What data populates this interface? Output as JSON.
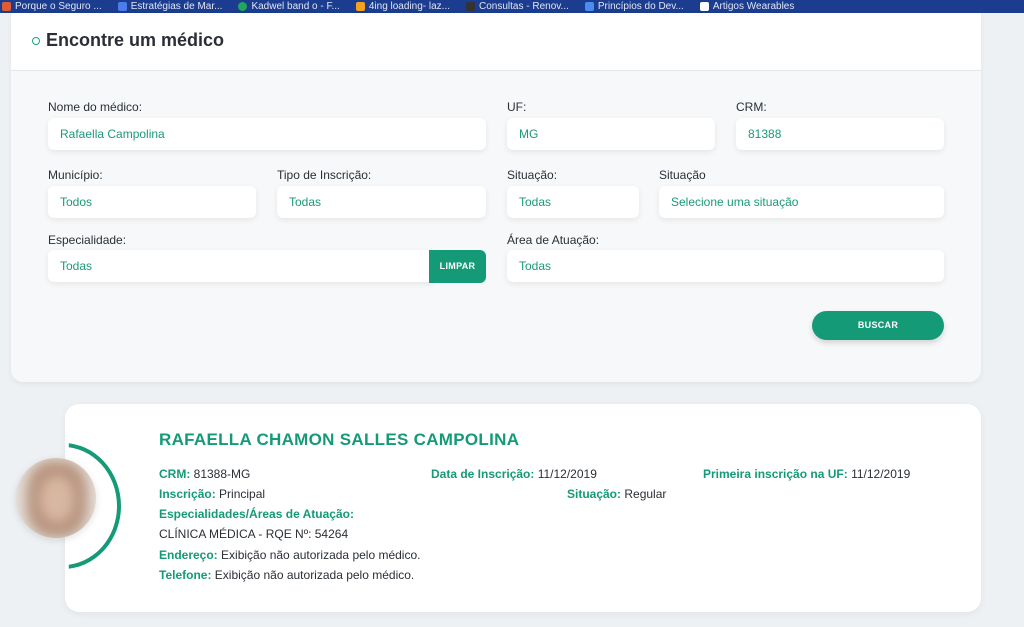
{
  "bookmarks": [
    {
      "label": "Porque o Seguro ...",
      "color": "#e35b2c"
    },
    {
      "label": "Estratégias de Mar...",
      "color": "#4b7bec"
    },
    {
      "label": "Kadwel band o - F...",
      "color": "#1fa85a"
    },
    {
      "label": "4ing loading- laz...",
      "color": "#f3a21c"
    },
    {
      "label": "Consultas - Renov...",
      "color": "#333333"
    },
    {
      "label": "Princípios do Dev...",
      "color": "#4a8cf0"
    },
    {
      "label": "Artigos Wearables",
      "color": "#ffffff"
    }
  ],
  "search": {
    "title": "Encontre um médico",
    "fields": {
      "nome": {
        "label": "Nome do médico:",
        "value": "Rafaella Campolina"
      },
      "uf": {
        "label": "UF:",
        "value": "MG"
      },
      "crm": {
        "label": "CRM:",
        "value": "81388"
      },
      "municipio": {
        "label": "Município:",
        "value": "Todos"
      },
      "tipo": {
        "label": "Tipo de Inscrição:",
        "value": "Todas"
      },
      "situacao1": {
        "label": "Situação:",
        "value": "Todas"
      },
      "situacao2": {
        "label": "Situação",
        "value": "Selecione uma situação"
      },
      "especialidade": {
        "label": "Especialidade:",
        "value": "Todas"
      },
      "area": {
        "label": "Área de Atuação:",
        "value": "Todas"
      }
    },
    "limpar_label": "LIMPAR",
    "buscar_label": "BUSCAR"
  },
  "result": {
    "name": "RAFAELLA CHAMON SALLES CAMPOLINA",
    "crm_key": "CRM:",
    "crm_value": " 81388-MG",
    "data_key": "Data de Inscrição:",
    "data_value": " 11/12/2019",
    "primeira_key": "Primeira inscrição na UF:",
    "primeira_value": " 11/12/2019",
    "inscricao_key": "Inscrição:",
    "inscricao_value": " Principal",
    "situacao_key": "Situação:",
    "situacao_value": " Regular",
    "especialidades_key": "Especialidades/Áreas de Atuação:",
    "especialidade_value": "CLÍNICA MÉDICA - RQE Nº: 54264",
    "endereco_key": "Endereço:",
    "endereco_value": " Exibição não autorizada pelo médico.",
    "telefone_key": "Telefone:",
    "telefone_value": " Exibição não autorizada pelo médico."
  },
  "colors": {
    "accent": "#159a77",
    "bookmarks_bar": "#1c3d8f"
  }
}
